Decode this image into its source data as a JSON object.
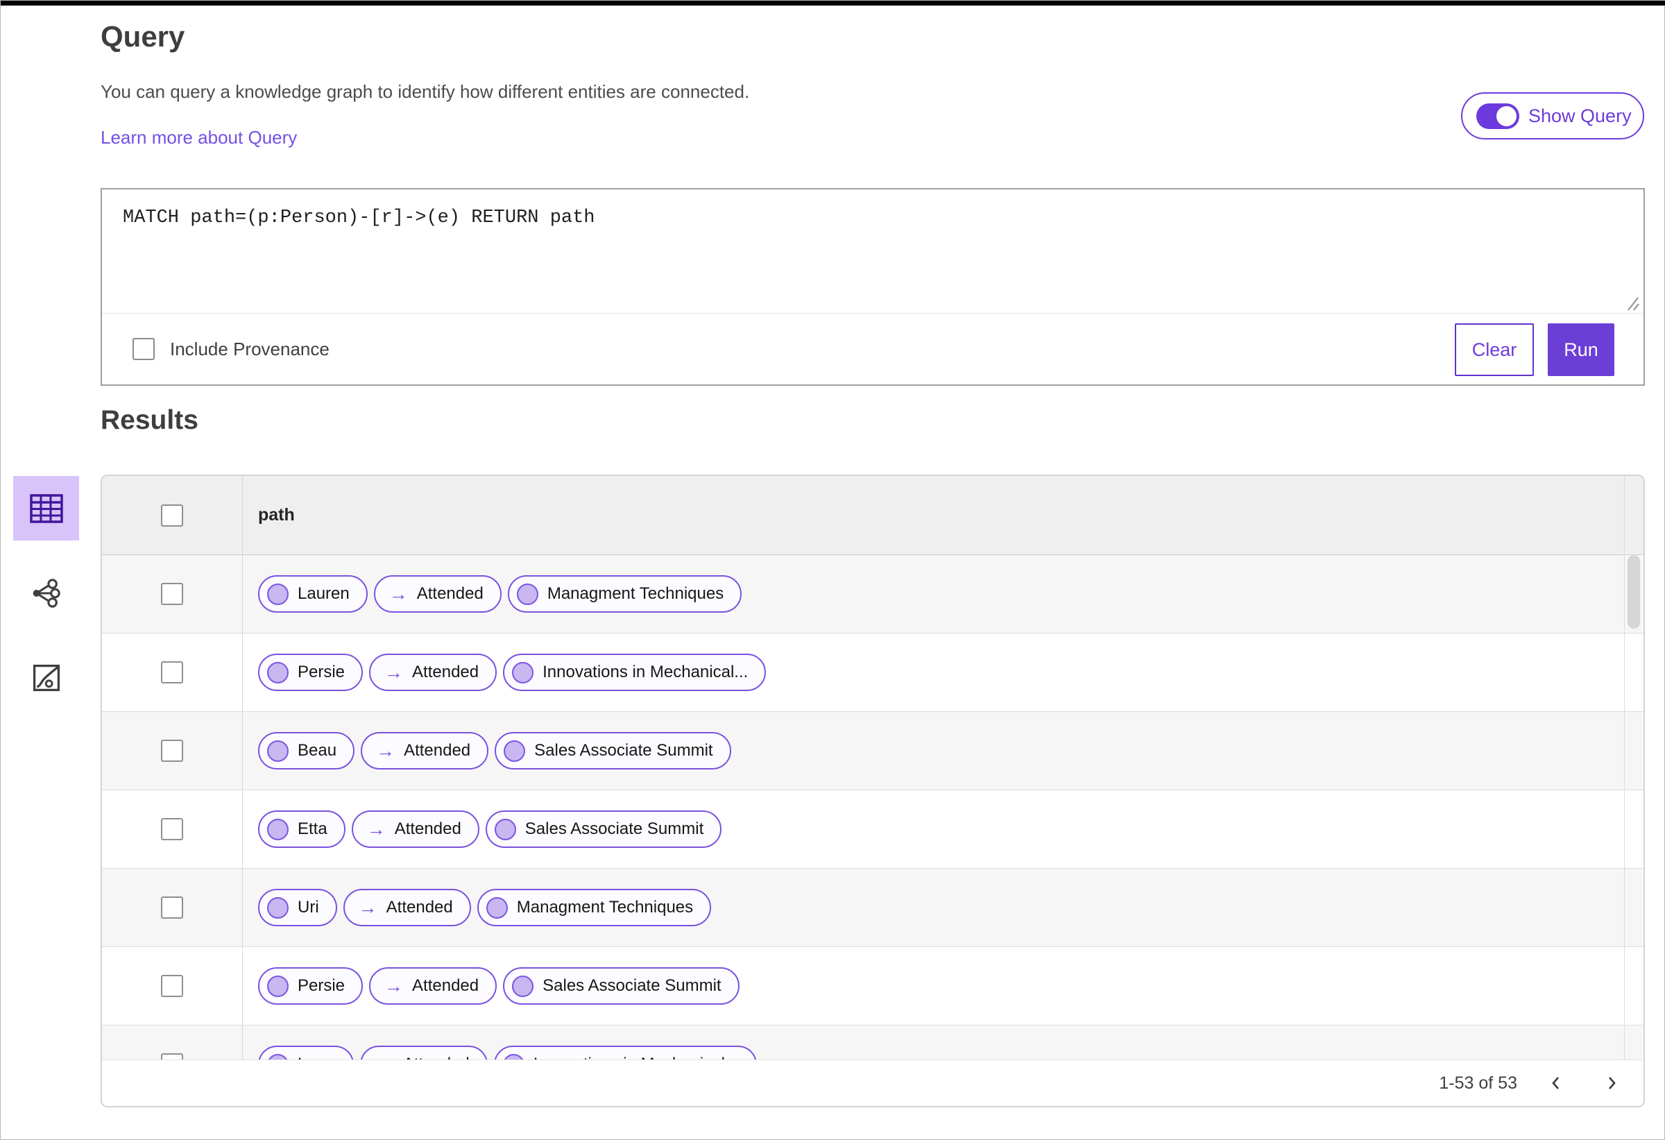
{
  "query_section": {
    "title": "Query",
    "description": "You can query a knowledge graph to identify how different entities are connected.",
    "learn_more_link": "Learn more about Query",
    "show_query_label": "Show Query",
    "show_query_on": true,
    "query_text": "MATCH path=(p:Person)-[r]->(e) RETURN path",
    "include_provenance_label": "Include Provenance",
    "include_provenance_checked": false,
    "clear_label": "Clear",
    "run_label": "Run"
  },
  "results_section": {
    "title": "Results",
    "column_header": "path",
    "views": [
      "table-view",
      "graph-view",
      "chart-view"
    ],
    "selected_view": "table-view",
    "rows": [
      {
        "person": "Lauren",
        "relation": "Attended",
        "entity": "Managment Techniques"
      },
      {
        "person": "Persie",
        "relation": "Attended",
        "entity": "Innovations in Mechanical..."
      },
      {
        "person": "Beau",
        "relation": "Attended",
        "entity": "Sales Associate Summit"
      },
      {
        "person": "Etta",
        "relation": "Attended",
        "entity": "Sales Associate Summit"
      },
      {
        "person": "Uri",
        "relation": "Attended",
        "entity": "Managment Techniques"
      },
      {
        "person": "Persie",
        "relation": "Attended",
        "entity": "Sales Associate Summit"
      },
      {
        "person": "Larry",
        "relation": "Attended",
        "entity": "Innovations in Mechanical..."
      }
    ],
    "pagination": {
      "range_label": "1-53 of 53"
    }
  },
  "icons": {
    "arrow_right": "→"
  },
  "colors": {
    "accent_purple": "#6d3bdd",
    "pill_border": "#7a52e0",
    "node_fill": "#c8b7f0",
    "selected_view_bg": "#d8c4f8"
  }
}
